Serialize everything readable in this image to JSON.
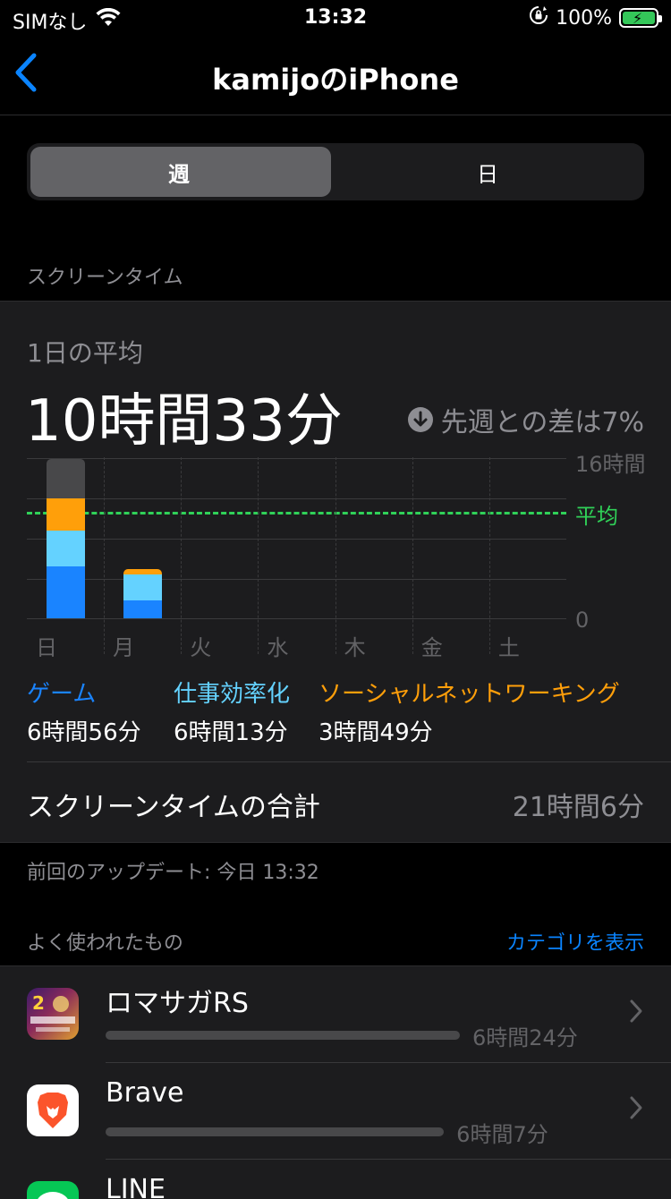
{
  "status": {
    "carrier": "SIMなし",
    "time": "13:32",
    "battery": "100%"
  },
  "nav": {
    "title": "kamijoのiPhone"
  },
  "segments": {
    "week": "週",
    "day": "日",
    "selected": "週"
  },
  "section_screen_time": "スクリーンタイム",
  "summary": {
    "avg_label": "1日の平均",
    "avg_value": "10時間33分",
    "diff_text": "先週との差は7%"
  },
  "chart_data": {
    "type": "bar",
    "stacked": true,
    "categories": [
      "日",
      "月",
      "火",
      "水",
      "木",
      "金",
      "土"
    ],
    "y_unit": "hours",
    "ylim": [
      0,
      16
    ],
    "y_tick_labels": [
      "16時間",
      "0"
    ],
    "average_label": "平均",
    "average": 10.55,
    "series": [
      {
        "name": "ゲーム",
        "color": "#1a84ff",
        "values": [
          5.2,
          1.75,
          0,
          0,
          0,
          0,
          0
        ]
      },
      {
        "name": "仕事効率化",
        "color": "#64d2ff",
        "values": [
          3.6,
          2.6,
          0,
          0,
          0,
          0,
          0
        ]
      },
      {
        "name": "ソーシャルネットワーキング",
        "color": "#ff9f0a",
        "values": [
          3.2,
          0.6,
          0,
          0,
          0,
          0,
          0
        ]
      },
      {
        "color": "#48484a",
        "values": [
          3.9,
          0,
          0,
          0,
          0,
          0,
          0
        ]
      }
    ]
  },
  "categories": [
    {
      "label": "ゲーム",
      "value": "6時間56分",
      "color": "#1a84ff"
    },
    {
      "label": "仕事効率化",
      "value": "6時間13分",
      "color": "#64d2ff"
    },
    {
      "label": "ソーシャルネットワーキング",
      "value": "3時間49分",
      "color": "#ff9f0a"
    }
  ],
  "total": {
    "label": "スクリーンタイムの合計",
    "value": "21時間6分"
  },
  "last_update": "前回のアップデート: 今日 13:32",
  "most_used": {
    "label": "よく使われたもの",
    "link": "カテゴリを表示"
  },
  "apps": [
    {
      "name": "ロマサガRS",
      "time": "6時間24分",
      "fraction": 1.0,
      "icon": "romasaga-app-icon"
    },
    {
      "name": "Brave",
      "time": "6時間7分",
      "fraction": 0.955,
      "icon": "brave-app-icon"
    },
    {
      "name": "LINE",
      "icon": "line-app-icon"
    }
  ]
}
